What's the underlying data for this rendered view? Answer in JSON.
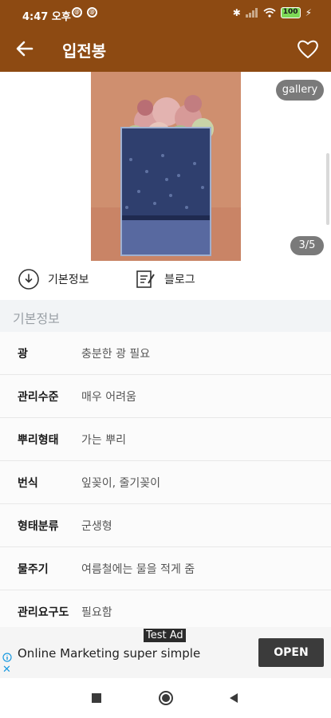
{
  "status_bar": {
    "time": "4:47 오후",
    "left_icons": [
      "messenger-icon",
      "messenger-icon"
    ],
    "right_icons": [
      "bluetooth-icon",
      "signal-icon",
      "wifi-icon"
    ],
    "battery": "100"
  },
  "app_bar": {
    "title": "입전봉",
    "back_icon": "arrow-left-icon",
    "favorite_icon": "heart-outline-icon"
  },
  "gallery": {
    "button_label": "gallery",
    "counter": "3/5"
  },
  "actions": {
    "basic_info_label": "기본정보",
    "blog_label": "블로그"
  },
  "section": {
    "title": "기본정보"
  },
  "info_rows": [
    {
      "label": "광",
      "value": "충분한 광 필요"
    },
    {
      "label": "관리수준",
      "value": "매우 어려움"
    },
    {
      "label": "뿌리형태",
      "value": "가는 뿌리"
    },
    {
      "label": "번식",
      "value": "잎꽂이, 줄기꽂이"
    },
    {
      "label": "형태분류",
      "value": "군생형"
    },
    {
      "label": "물주기",
      "value": "여름철에는 물을 적게 줌"
    },
    {
      "label": "관리요구도",
      "value": "필요함"
    }
  ],
  "ad": {
    "tag": "Test Ad",
    "text": "Online Marketing super simple",
    "cta": "OPEN"
  },
  "colors": {
    "app_bar": "#8d4a12",
    "section_bg": "#f2f4f6",
    "ad_button": "#3b3b3b"
  }
}
